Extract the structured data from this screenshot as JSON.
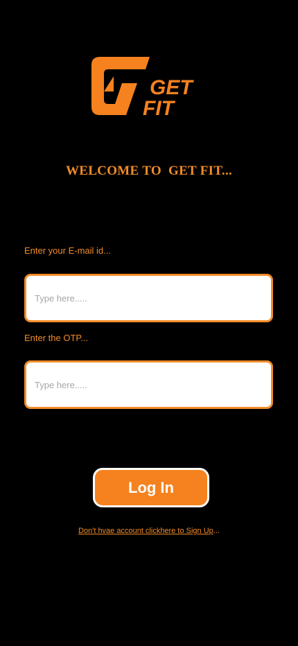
{
  "brand": {
    "logo_text_line1": "GET",
    "logo_text_line2": "FIT",
    "accent_color": "#F5821F"
  },
  "header": {
    "welcome": "WELCOME TO  GET FIT..."
  },
  "form": {
    "email_label": "Enter your E-mail id...",
    "email_placeholder": "Type here.....",
    "email_value": "",
    "otp_label": "Enter the OTP...",
    "otp_placeholder": "Type here.....",
    "otp_value": ""
  },
  "actions": {
    "login_label": "Log In",
    "signup_link_text": "Don't hvae account clickhere to Sign Up",
    "signup_suffix": "..."
  }
}
